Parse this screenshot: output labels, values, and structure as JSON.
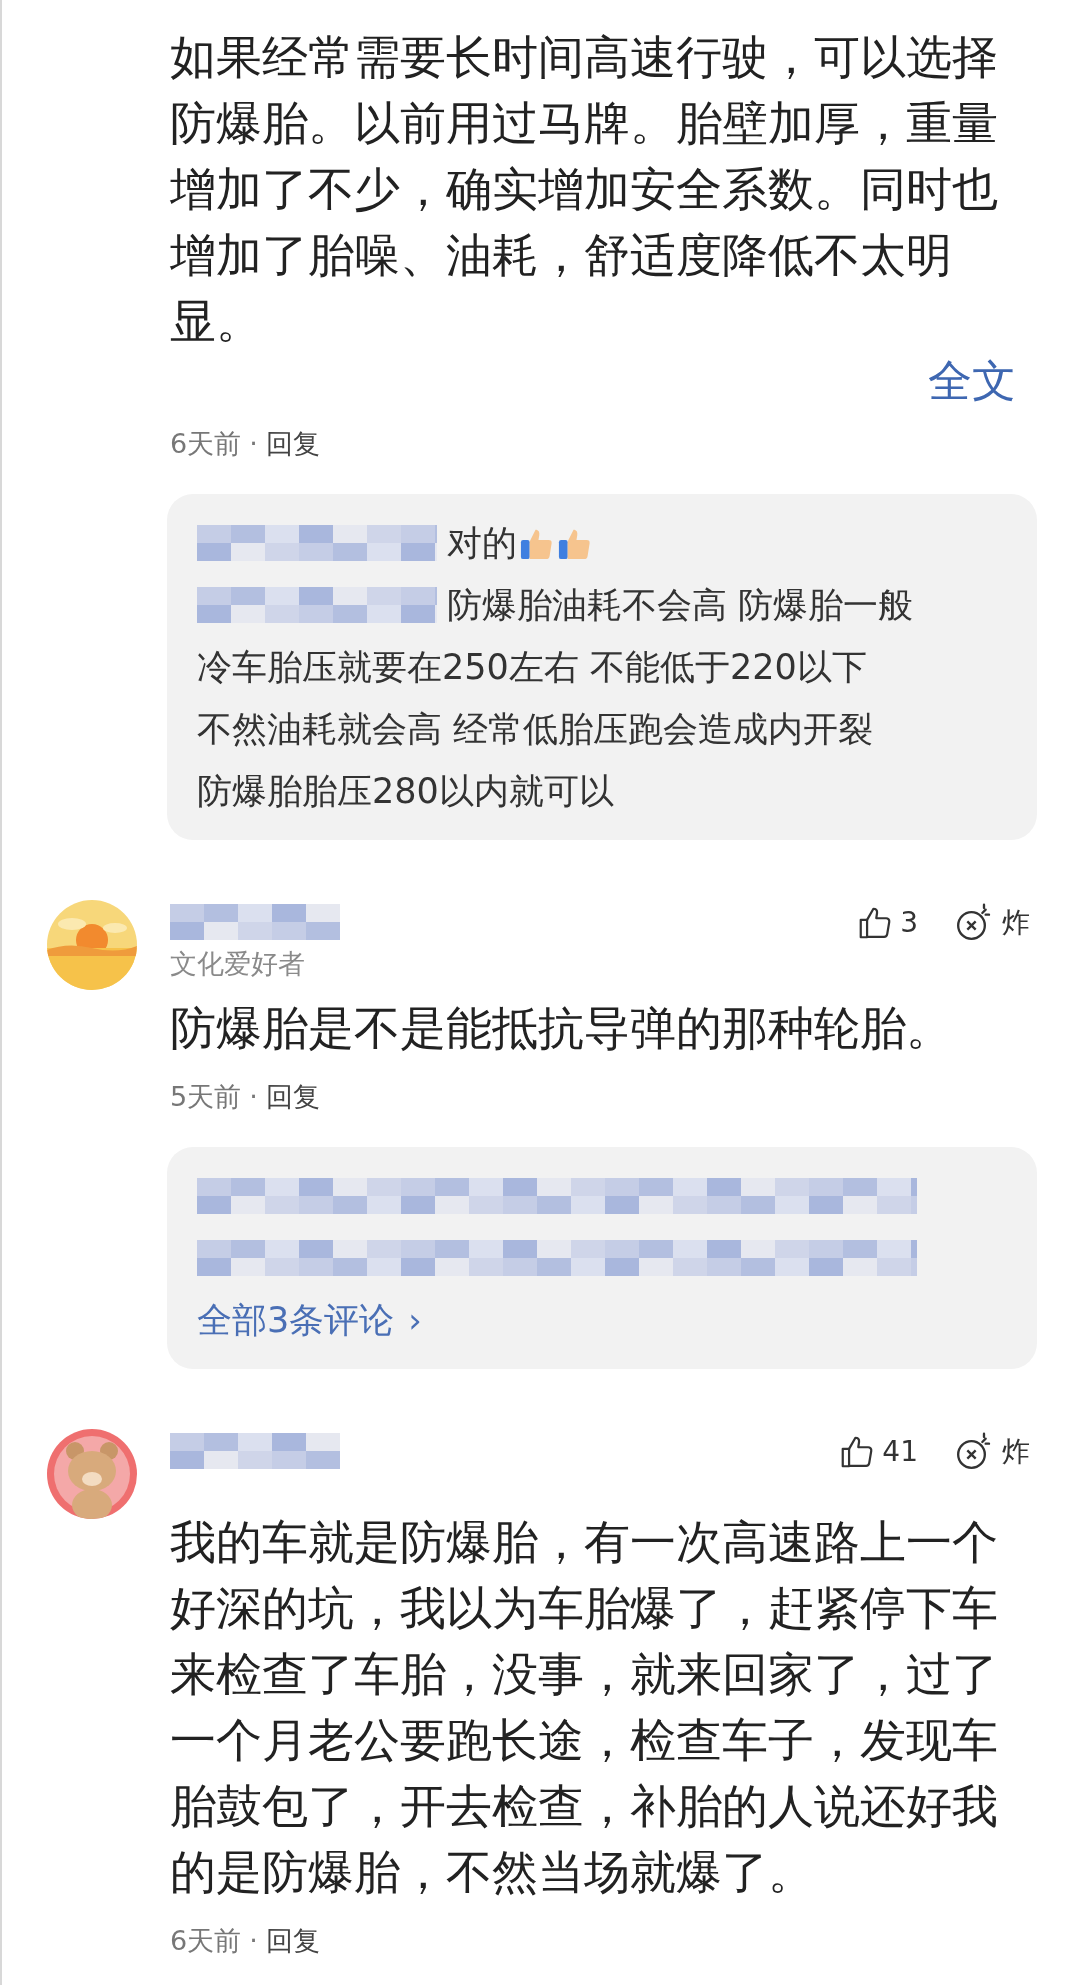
{
  "comments": [
    {
      "text": "如果经常需要长时间高速行驶，可以选择防爆胎。以前用过马牌。胎壁加厚，重量增加了不少，确实增加安全系数。同时也增加了胎噪、油耗，舒适度降低不太明显。",
      "more": "全文",
      "time": "6天前",
      "separator": "·",
      "reply": "回复",
      "thread": {
        "lines": [
          {
            "hidden_prefix": true,
            "text": "对的",
            "emojis": [
              {
                "kind": "thumbs-up"
              },
              {
                "kind": "thumbs-up"
              }
            ]
          },
          {
            "hidden_prefix": true,
            "text": "防爆胎油耗不会高 防爆胎一般"
          },
          {
            "hidden_prefix": false,
            "text": "冷车胎压就要在250左右 不能低于220以下"
          },
          {
            "hidden_prefix": false,
            "text": "不然油耗就会高 经常低胎压跑会造成内开裂"
          },
          {
            "hidden_prefix": false,
            "text": "防爆胎胎压280以内就可以"
          }
        ]
      }
    },
    {
      "name_hidden": true,
      "badge": "文化爱好者",
      "likes": "3",
      "bomb": "炸",
      "text": "防爆胎是不是能抵抗导弹的那种轮胎。",
      "time": "5天前",
      "separator": "·",
      "reply": "回复",
      "thread": {
        "lines": [
          {
            "hidden_prefix": true
          },
          {
            "hidden_prefix": true
          }
        ],
        "all": "全部3条评论",
        "chevron": "›"
      }
    },
    {
      "name_hidden": true,
      "likes": "41",
      "bomb": "炸",
      "text": "我的车就是防爆胎，有一次高速路上一个好深的坑，我以为车胎爆了，赶紧停下车来检查了车胎，没事，就来回家了，过了一个月老公要跑长途，检查车子，发现车胎鼓包了，开去检查，补胎的人说还好我的是防爆胎，不然当场就爆了。",
      "time": "6天前",
      "separator": "·",
      "reply": "回复"
    }
  ]
}
